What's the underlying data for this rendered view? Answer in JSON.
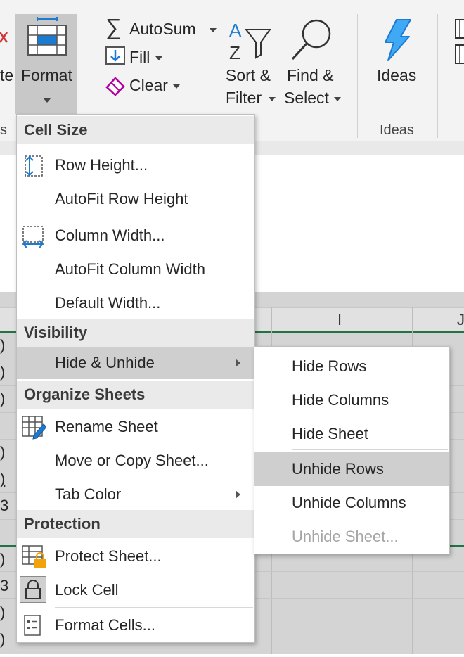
{
  "ribbon": {
    "delete_partial": "te",
    "format_label": "Format",
    "autosum_label": "AutoSum",
    "fill_label": "Fill",
    "clear_label": "Clear",
    "sort_filter_line1": "Sort &",
    "sort_filter_line2": "Filter",
    "find_select_line1": "Find &",
    "find_select_line2": "Select",
    "ideas_label": "Ideas",
    "ideas_group_label": "Ideas",
    "cells_group_partial": "s"
  },
  "sheet": {
    "column_i": "I",
    "column_j_partial": "J",
    "left_edge_chars": [
      ")",
      ")",
      ")",
      "",
      ")",
      ")",
      "3",
      "",
      ")",
      "3",
      ")",
      ")"
    ]
  },
  "format_menu": {
    "sections": {
      "cell_size": "Cell Size",
      "visibility": "Visibility",
      "organize_sheets": "Organize Sheets",
      "protection": "Protection"
    },
    "items": {
      "row_height": "Row Height...",
      "autofit_row_height": "AutoFit Row Height",
      "column_width": "Column Width...",
      "autofit_column_width": "AutoFit Column Width",
      "default_width": "Default Width...",
      "hide_unhide": "Hide & Unhide",
      "rename_sheet": "Rename Sheet",
      "move_copy_sheet": "Move or Copy Sheet...",
      "tab_color": "Tab Color",
      "protect_sheet": "Protect Sheet...",
      "lock_cell": "Lock Cell",
      "format_cells": "Format Cells..."
    }
  },
  "hide_unhide_submenu": {
    "hide_rows": "Hide Rows",
    "hide_columns": "Hide Columns",
    "hide_sheet": "Hide Sheet",
    "unhide_rows": "Unhide Rows",
    "unhide_columns": "Unhide Columns",
    "unhide_sheet": "Unhide Sheet..."
  },
  "colors": {
    "accent_blue": "#1c7bd1",
    "excel_green": "#217346",
    "highlight": "#cfcfcf",
    "disabled_text": "#a6a6a6",
    "lock_orange": "#f0a30a",
    "clear_magenta": "#b4009e"
  }
}
